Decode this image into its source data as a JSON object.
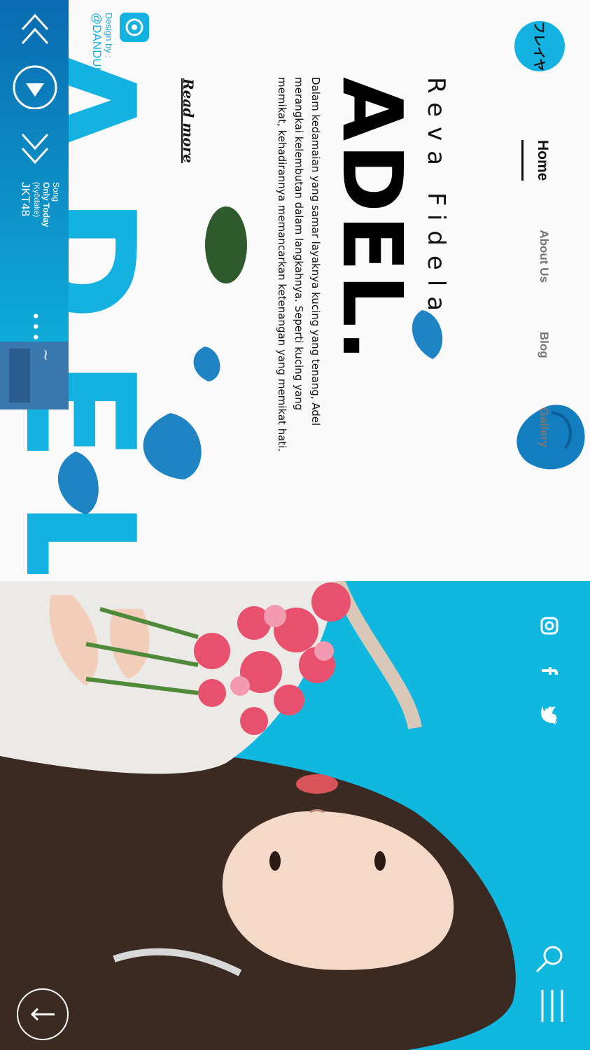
{
  "brand": {
    "logo_text": "フレイヤ"
  },
  "nav": [
    {
      "label": "Home",
      "active": true
    },
    {
      "label": "About Us",
      "active": false
    },
    {
      "label": "Blog",
      "active": false
    },
    {
      "label": "Gallery",
      "active": false
    }
  ],
  "hero": {
    "subtitle": "Reva Fidela",
    "title": "ADEL.",
    "description": "Dalam kedamaian yang samar layaknya kucing yang tenang, Adel merangkai kelembutan dalam langkahnya. Seperti kucing yang memikat, kehadirannya memancarkan ketenangan yang memikat hati.",
    "read_more": "Read more",
    "background_word": "ADEL"
  },
  "credit": {
    "label": "Design by :",
    "name": "@DANDULLD"
  },
  "player": {
    "song_label": "Song",
    "song_title": "Only Today",
    "song_subtitle": "(Kyōdake)",
    "artist": "JKT48",
    "controls": [
      "rewind-icon",
      "play-icon",
      "fast-forward-icon"
    ],
    "more": "•••"
  },
  "social": [
    "instagram-icon",
    "facebook-icon",
    "twitter-icon"
  ],
  "colors": {
    "accent": "#13b2e0",
    "player_start": "#0a6bb0",
    "text": "#111111"
  }
}
